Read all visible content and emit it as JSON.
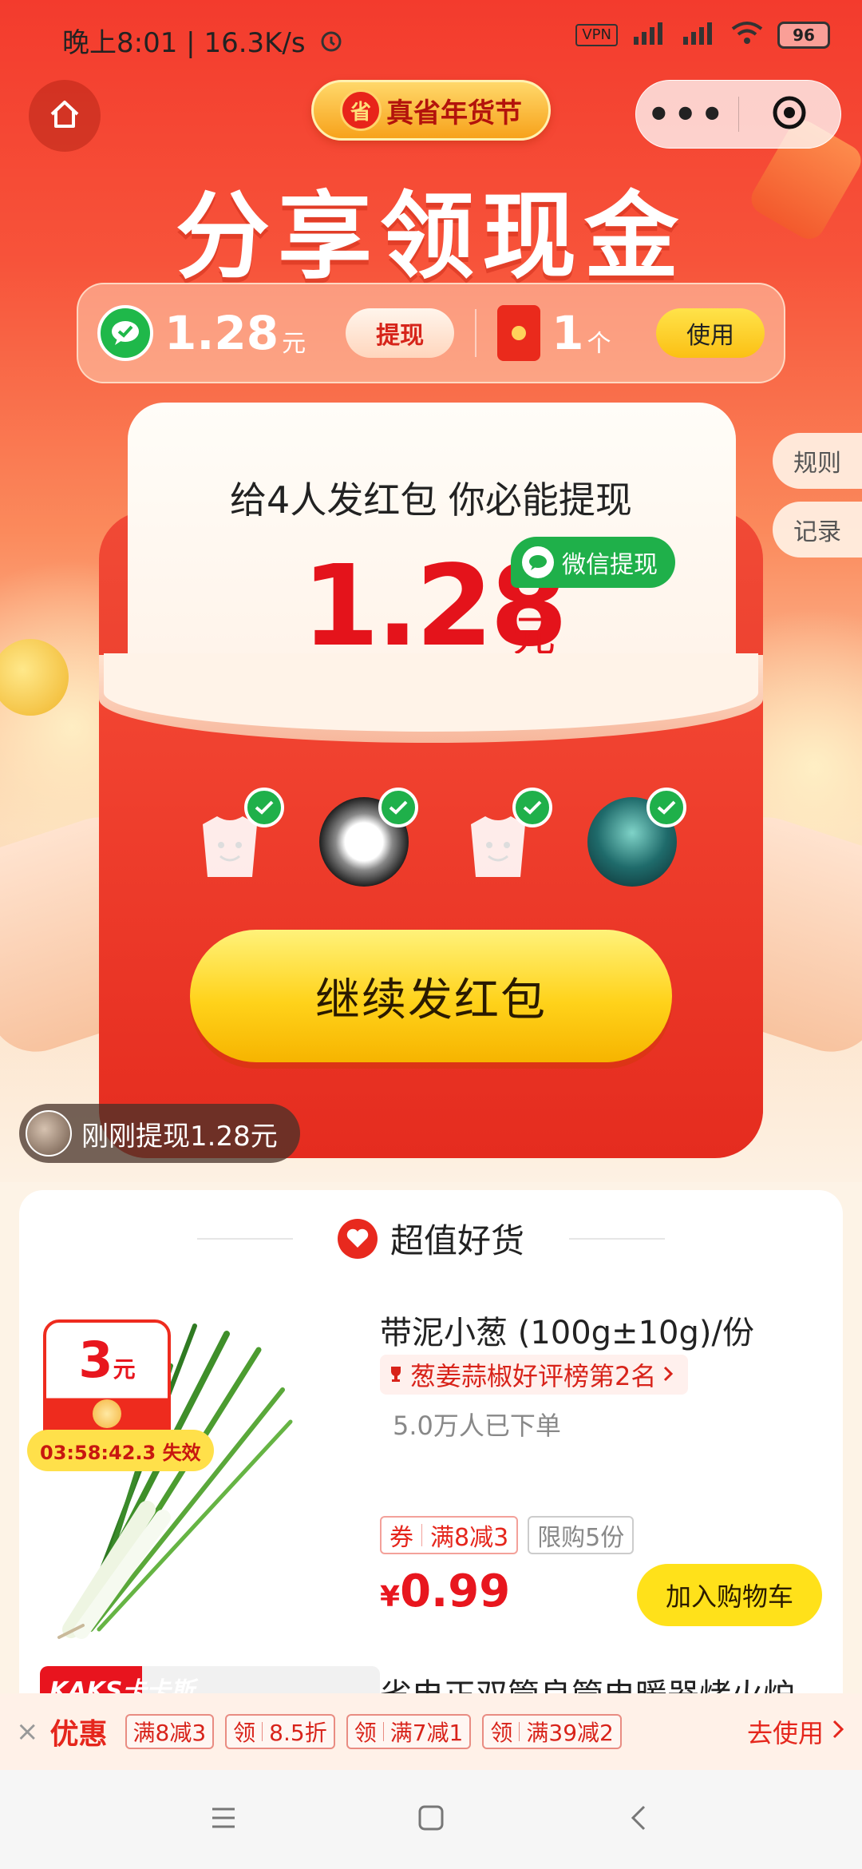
{
  "status_bar": {
    "time": "晚上8:01",
    "speed": "16.3K/s",
    "vpn": "VPN",
    "battery": "96"
  },
  "header": {
    "festival_badge_icon": "省",
    "festival_badge": "真省年货节",
    "title": "分享领现金"
  },
  "balance": {
    "cash_amount": "1.28",
    "cash_unit": "元",
    "withdraw_label": "提现",
    "envelope_count": "1",
    "envelope_unit": "个",
    "use_label": "使用"
  },
  "side_tabs": {
    "rules": "规则",
    "records": "记录"
  },
  "envelope": {
    "title": "给4人发红包 你必能提现",
    "amount": "1.28",
    "unit": "元",
    "wechat_withdraw": "微信提现",
    "invited_count": 4,
    "continue_label": "继续发红包"
  },
  "toast": {
    "text": "刚刚提现1.28元"
  },
  "products": {
    "section_title": "超值好货",
    "items": [
      {
        "coupon_value": "3",
        "coupon_unit": "元",
        "countdown": "03:58:42.3 失效",
        "name": "带泥小葱 (100g±10g)/份",
        "rank": "葱姜蒜椒好评榜第2名",
        "sold": "5.0万人已下单",
        "coupon_tag_a": "券",
        "coupon_tag_b": "满8减3",
        "limit": "限购5份",
        "price_symbol": "¥",
        "price": "0.99",
        "cart_label": "加入购物车"
      },
      {
        "logo": "KAKS卡卡斯",
        "name": "省电正双管良管电暖器烤火炉"
      }
    ]
  },
  "promo": {
    "close": "×",
    "title": "优惠",
    "tags": [
      {
        "a": "满8减3"
      },
      {
        "a": "领",
        "b": "8.5折"
      },
      {
        "a": "领",
        "b": "满7减1"
      },
      {
        "a": "领",
        "b": "满39减2"
      }
    ],
    "go_label": "去使用"
  },
  "colors": {
    "brand_red": "#e4131b",
    "wechat_green": "#1fb04a",
    "button_yellow": "#ffd21a"
  }
}
